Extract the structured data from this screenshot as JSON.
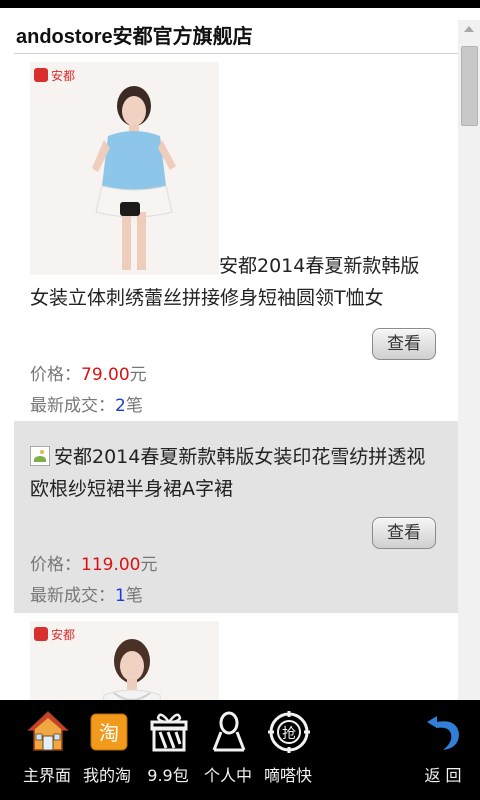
{
  "store": {
    "title": "andostore安都官方旗舰店"
  },
  "products": [
    {
      "title": "安都2014春夏新款韩版女装立体刺绣蕾丝拼接修身短袖圆领T恤女",
      "view_label": "查看",
      "price_label": "价格：",
      "price_value": "79.00",
      "price_unit": "元",
      "deal_label": "最新成交：",
      "deal_count": "2",
      "deal_unit": "笔",
      "image_brand": "安都"
    },
    {
      "title": "安都2014春夏新款韩版女装印花雪纺拼透视欧根纱短裙半身裙A字裙",
      "view_label": "查看",
      "price_label": "价格：",
      "price_value": "119.00",
      "price_unit": "元",
      "deal_label": "最新成交：",
      "deal_count": "1",
      "deal_unit": "笔"
    },
    {
      "image_brand": "安都"
    }
  ],
  "bottom_nav": [
    {
      "label": "主界面",
      "icon": "home-icon"
    },
    {
      "label": "我的淘",
      "icon": "tao-icon"
    },
    {
      "label": "9.9包",
      "icon": "gift-box-icon"
    },
    {
      "label": "个人中",
      "icon": "person-icon"
    },
    {
      "label": "嘀嗒快",
      "icon": "grab-icon"
    },
    {
      "label": "返 回",
      "icon": "back-icon"
    }
  ],
  "colors": {
    "price": "#dd1111",
    "deal_count": "#1a3dd6",
    "selected_row": "#e3e3e3",
    "nav_bg": "#000000"
  }
}
